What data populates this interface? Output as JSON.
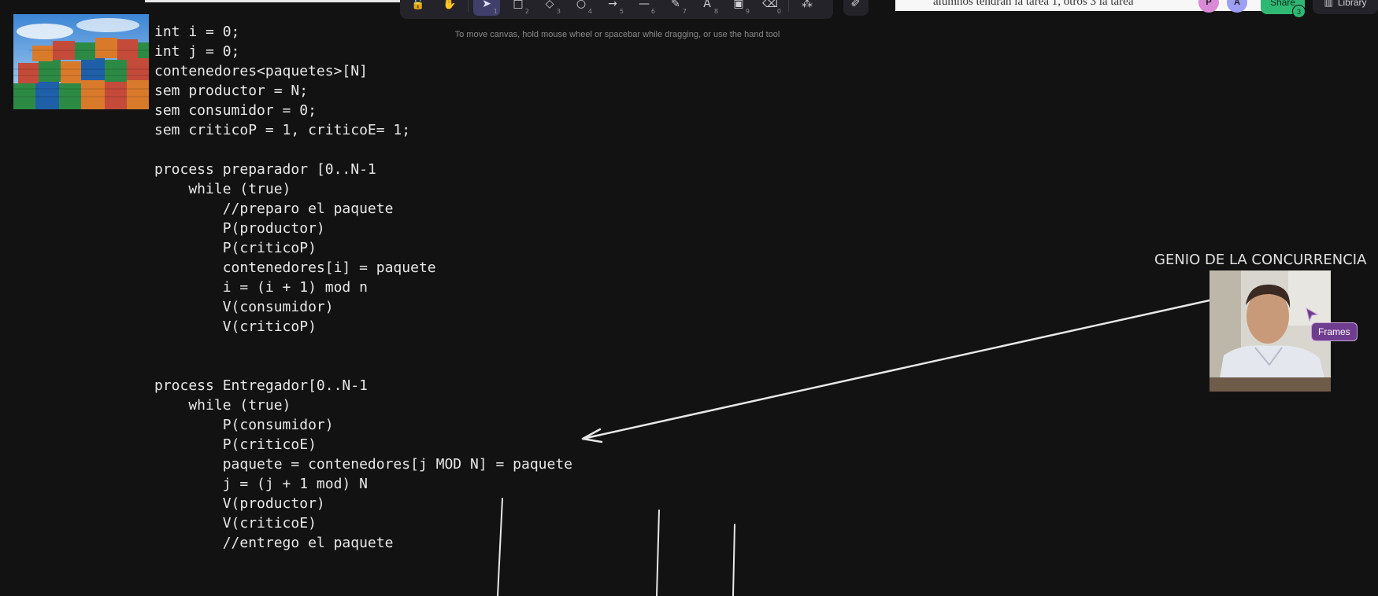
{
  "toolbar": {
    "tools": [
      {
        "name": "lock-icon",
        "glyph": "🔓",
        "key": ""
      },
      {
        "name": "hand-icon",
        "glyph": "✋",
        "key": ""
      },
      {
        "name": "selection-icon",
        "glyph": "➤",
        "key": "1",
        "active": true
      },
      {
        "name": "rectangle-icon",
        "glyph": "□",
        "key": "2"
      },
      {
        "name": "diamond-icon",
        "glyph": "◇",
        "key": "3"
      },
      {
        "name": "ellipse-icon",
        "glyph": "○",
        "key": "4"
      },
      {
        "name": "arrow-icon",
        "glyph": "→",
        "key": "5"
      },
      {
        "name": "line-icon",
        "glyph": "—",
        "key": "6"
      },
      {
        "name": "draw-icon",
        "glyph": "✎",
        "key": "7"
      },
      {
        "name": "text-icon",
        "glyph": "A",
        "key": "8"
      },
      {
        "name": "image-icon",
        "glyph": "▣",
        "key": "9"
      },
      {
        "name": "eraser-icon",
        "glyph": "⌫",
        "key": "0"
      },
      {
        "name": "more-tools-icon",
        "glyph": "⁂",
        "key": ""
      }
    ],
    "extra_tool": {
      "name": "laser-pointer-icon",
      "glyph": "✐"
    }
  },
  "hint": "To move canvas, hold mouse wheel or spacebar while dragging, or use the hand tool",
  "doc_strip": {
    "text": "alumnos tendrán la tarea 1, otros 3 la tarea"
  },
  "collaborators": [
    {
      "initial": "P",
      "color": "#d98ad6"
    },
    {
      "initial": "A",
      "color": "#9e9ef5"
    }
  ],
  "share": {
    "label": "Share",
    "count": "3"
  },
  "library": {
    "label": "Library"
  },
  "code_lines": [
    "int i = 0;",
    "int j = 0;",
    "contenedores<paquetes>[N]",
    "sem productor = N;",
    "sem consumidor = 0;",
    "sem criticoP = 1, criticoE= 1;",
    "",
    "process preparador [0..N-1",
    "    while (true)",
    "        //preparo el paquete",
    "        P(productor)",
    "        P(criticoP)",
    "        contenedores[i] = paquete",
    "        i = (i + 1) mod n",
    "        V(consumidor)",
    "        V(criticoP)",
    "",
    "",
    "process Entregador[0..N-1",
    "    while (true)",
    "        P(consumidor)",
    "        P(criticoE)",
    "        paquete = contenedores[j MOD N] = paquete",
    "        j = (j + 1 mod) N",
    "        V(productor)",
    "        V(criticoE)",
    "        //entrego el paquete"
  ],
  "genio": {
    "title": "GENIO DE LA CONCURRENCIA",
    "cursor_label": "Frames"
  },
  "colors": {
    "background": "#121212",
    "stroke": "#e8e8e8",
    "accent": "#403e6a",
    "share": "#2fb874",
    "collab_tag": "#6f3d8f"
  }
}
